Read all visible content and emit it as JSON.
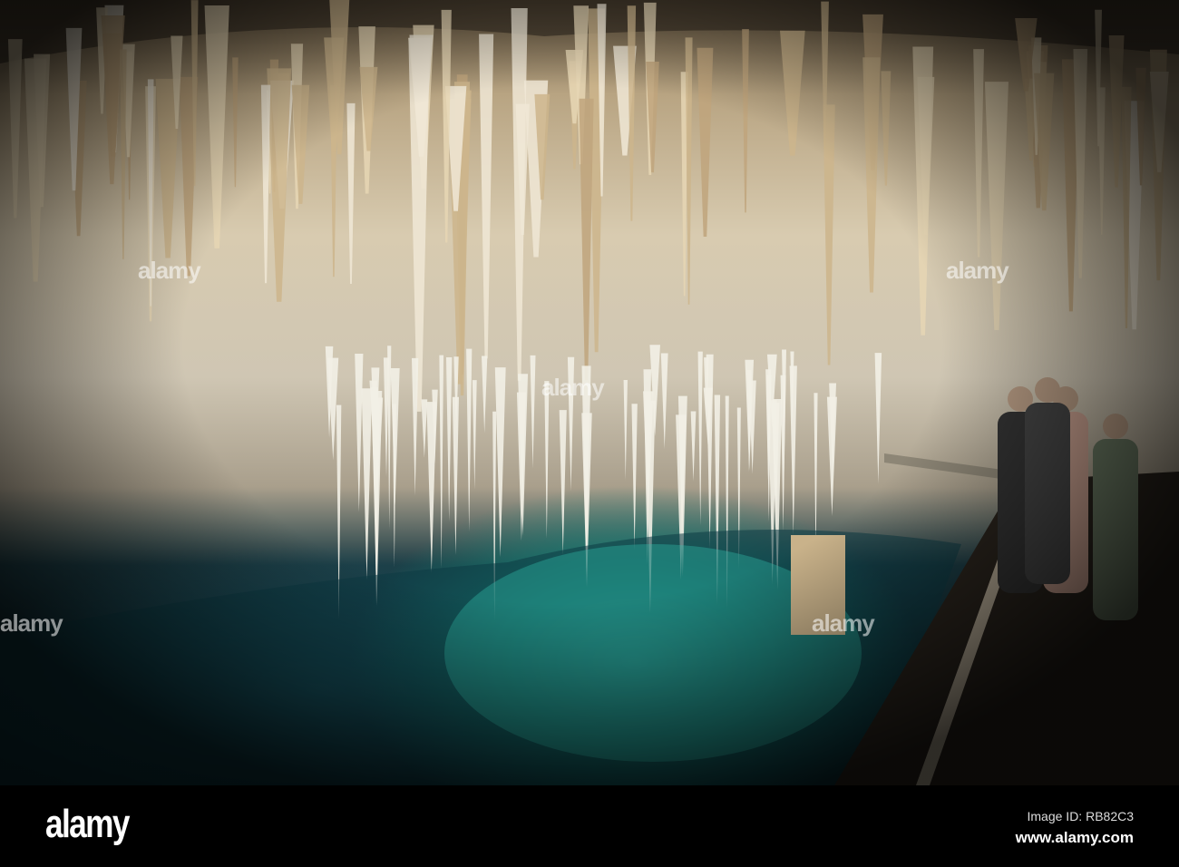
{
  "photo": {
    "subject": "cave",
    "colors": {
      "rock": "#d8cbb0",
      "water": "#2fb3a3",
      "dark": "#081a20"
    },
    "watermark_text": "alamy"
  },
  "footer": {
    "logo": "alamy",
    "image_id": "Image ID: RB82C3",
    "url": "www.alamy.com"
  }
}
